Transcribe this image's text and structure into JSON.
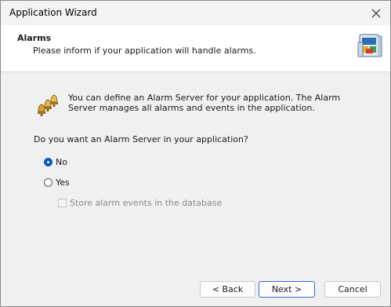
{
  "window": {
    "title": "Application Wizard"
  },
  "header": {
    "title": "Alarms",
    "subtitle": "Please inform if your application will handle alarms."
  },
  "body": {
    "info": "You can define an Alarm Server for your application. The Alarm Server manages all alarms and events in the application.",
    "question": "Do you want an Alarm Server in your application?",
    "options": [
      {
        "label": "No",
        "selected": true
      },
      {
        "label": "Yes",
        "selected": false
      }
    ],
    "store_events_label": "Store alarm events in the database"
  },
  "footer": {
    "back_label": "< Back",
    "next_label": "Next >",
    "cancel_label": "Cancel"
  },
  "icons": {
    "close": "close-icon",
    "header": "wizard-app-icon",
    "alarm": "alarm-bells-icon"
  },
  "colors": {
    "accent": "#0a5bc4",
    "header_bg": "#ffffff",
    "dialog_bg": "#f0f0f0"
  }
}
